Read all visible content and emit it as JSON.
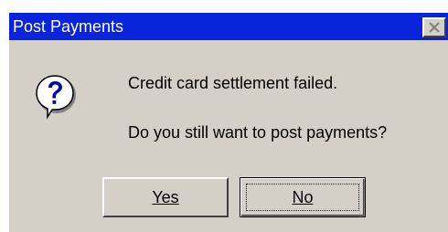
{
  "window": {
    "title": "Post Payments"
  },
  "icons": {
    "close": "close-icon",
    "message": "question-icon"
  },
  "message": {
    "line1": "Credit card settlement failed.",
    "line2": "Do you still want to post payments?"
  },
  "buttons": {
    "yes_label": "Yes",
    "no_label": "No"
  },
  "colors": {
    "titlebar": "#0a24dc",
    "dialog_bg": "#d4d0c8",
    "icon_bubble": "#ffffff",
    "icon_mark": "#0000aa"
  }
}
